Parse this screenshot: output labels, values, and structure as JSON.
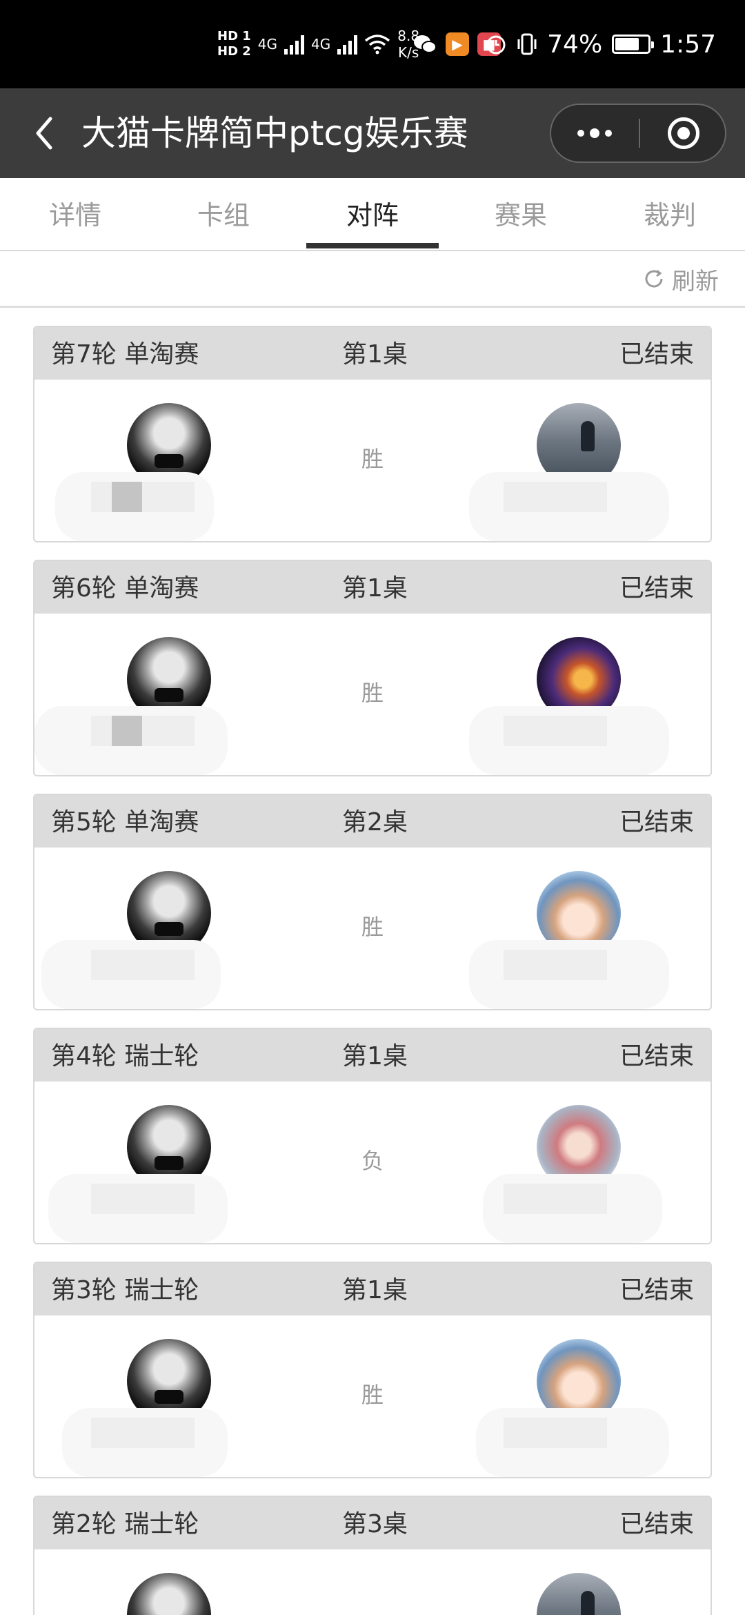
{
  "status_bar": {
    "hd1": "HD 1",
    "hd2": "HD 2",
    "net1": "4G",
    "net2": "4G",
    "speed_value": "8.8",
    "speed_unit": "K/s",
    "battery": "74%",
    "battery_level": 0.74,
    "time": "1:57"
  },
  "nav": {
    "title": "大猫卡牌简中ptcg娱乐赛"
  },
  "tabs": [
    {
      "label": "详情"
    },
    {
      "label": "卡组"
    },
    {
      "label": "对阵"
    },
    {
      "label": "赛果"
    },
    {
      "label": "裁判"
    }
  ],
  "active_tab": "对阵",
  "refresh_label": "刷新",
  "matches": [
    {
      "round": "第7轮 单淘赛",
      "table": "第1桌",
      "status": "已结束",
      "result": "胜"
    },
    {
      "round": "第6轮 单淘赛",
      "table": "第1桌",
      "status": "已结束",
      "result": "胜"
    },
    {
      "round": "第5轮 单淘赛",
      "table": "第2桌",
      "status": "已结束",
      "result": "胜"
    },
    {
      "round": "第4轮 瑞士轮",
      "table": "第1桌",
      "status": "已结束",
      "result": "负"
    },
    {
      "round": "第3轮 瑞士轮",
      "table": "第1桌",
      "status": "已结束",
      "result": "胜"
    },
    {
      "round": "第2轮 瑞士轮",
      "table": "第3桌",
      "status": "已结束",
      "result": ""
    }
  ]
}
